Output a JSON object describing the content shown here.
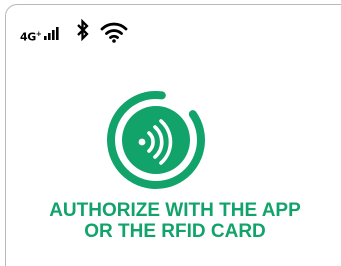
{
  "status_bar": {
    "network_label": "4G",
    "network_superscript": "+",
    "signal_icon": "signal-bars-icon",
    "bluetooth_icon": "bluetooth-icon",
    "wifi_icon": "wifi-icon"
  },
  "main": {
    "icon": "rfid-contactless-icon",
    "message_line1": "AUTHORIZE WITH THE APP",
    "message_line2": "OR THE RFID CARD"
  },
  "colors": {
    "accent": "#12a36b",
    "accent_dark": "#0f8f5d",
    "text_dark": "#000000",
    "border": "#b9b9b9"
  }
}
